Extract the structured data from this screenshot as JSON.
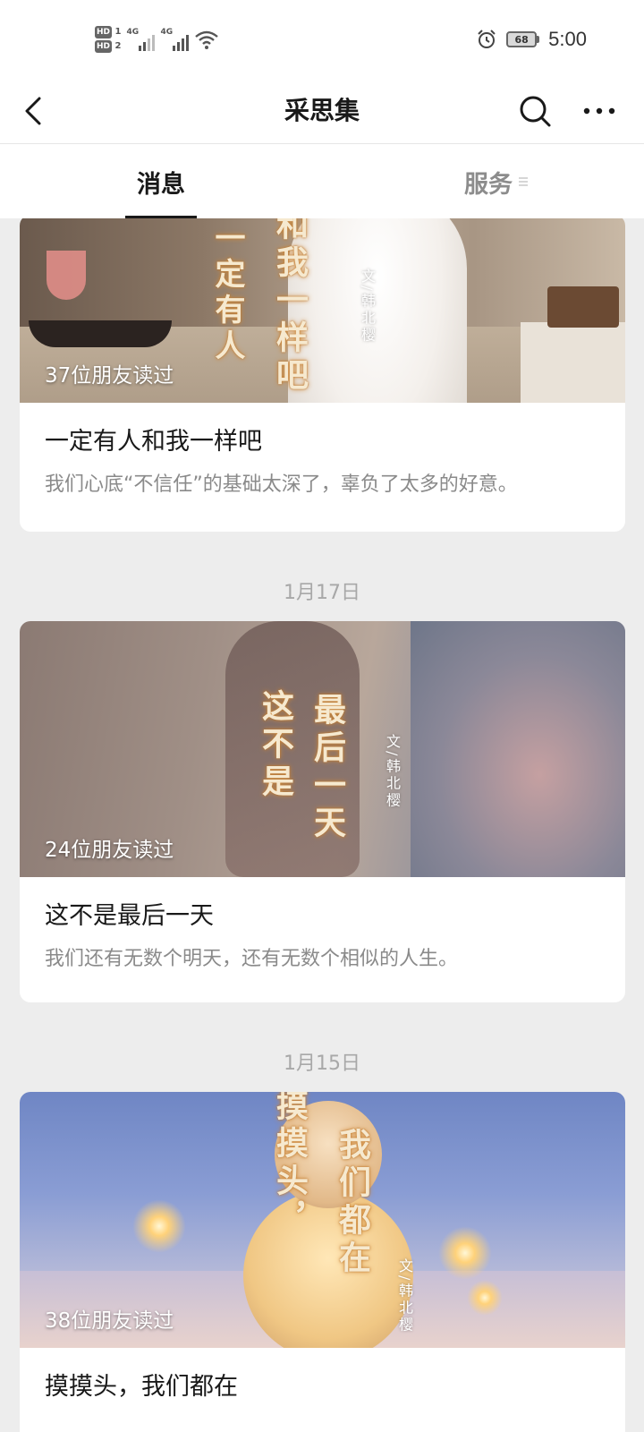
{
  "status_bar": {
    "hd1": "HD",
    "hd1_sub": "1",
    "hd2": "HD",
    "hd2_sub": "2",
    "net1": "4G",
    "net2": "4G",
    "battery": "68",
    "time": "5:00"
  },
  "nav": {
    "title": "采思集"
  },
  "tabs": [
    {
      "label": "消息",
      "active": true
    },
    {
      "label": "服务",
      "active": false
    }
  ],
  "articles": [
    {
      "cover_title": "一定有人和我一样吧",
      "cover_title_col1": "一定有人",
      "cover_title_col2": "和我一样吧",
      "byline": "文/韩北樱",
      "readers": "37位朋友读过",
      "title": "一定有人和我一样吧",
      "desc": "我们心底“不信任”的基础太深了，辜负了太多的好意。"
    },
    {
      "date": "1月17日",
      "cover_title_col1": "这不是",
      "cover_title_col2": "最后一天",
      "byline": "文/韩北樱",
      "readers": "24位朋友读过",
      "title": "这不是最后一天",
      "desc": "我们还有无数个明天，还有无数个相似的人生。"
    },
    {
      "date": "1月15日",
      "cover_title_col1": "摸摸头，",
      "cover_title_col2": "我们都在",
      "byline": "文/韩北樱",
      "readers": "38位朋友读过",
      "title": "摸摸头，我们都在"
    }
  ],
  "icons": {
    "back": "chevron-left-icon",
    "search": "search-icon",
    "more": "more-dots-icon",
    "alarm": "alarm-icon",
    "wifi": "wifi-icon",
    "battery": "battery-icon"
  },
  "colors": {
    "nav_bg": "#ffffff",
    "page_bg": "#ededed",
    "active_tab": "#191919",
    "inactive_tab": "#8c8c8c",
    "desc_text": "#8a8a8a"
  }
}
